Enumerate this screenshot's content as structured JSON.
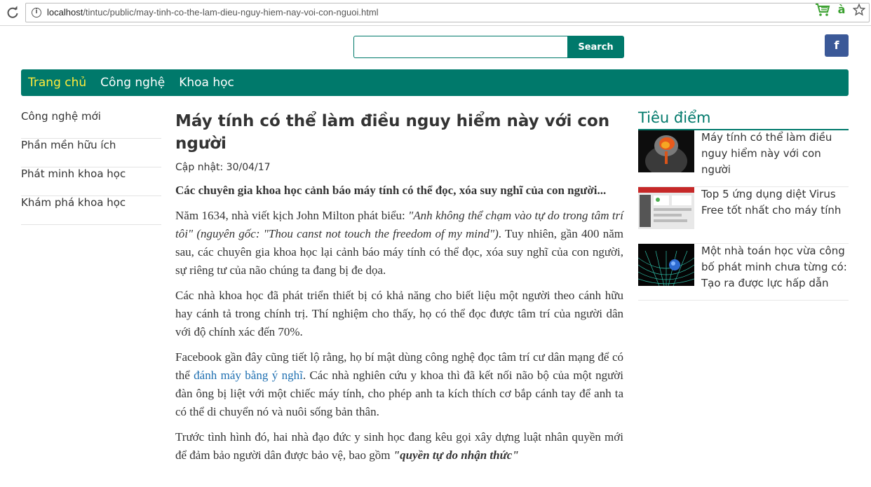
{
  "browser": {
    "url_host": "localhost",
    "url_path": "/tintuc/public/may-tinh-co-the-lam-dieu-nguy-hiem-nay-voi-con-nguoi.html",
    "icons": [
      "reload-icon",
      "info-icon",
      "cart-icon",
      "star-icon"
    ],
    "ext_letter": "à"
  },
  "search": {
    "value": "",
    "placeholder": "",
    "button_label": "Search"
  },
  "facebook": {
    "label": "f",
    "color": "#3b5998"
  },
  "nav": {
    "color": "#00796b",
    "items": [
      {
        "label": "Trang chủ",
        "active": true
      },
      {
        "label": "Công nghệ",
        "active": false
      },
      {
        "label": "Khoa học",
        "active": false
      }
    ]
  },
  "sidebar": {
    "items": [
      {
        "label": "Công nghệ mới"
      },
      {
        "label": "Phần mền hữu ích"
      },
      {
        "label": "Phát minh khoa học"
      },
      {
        "label": "Khám phá khoa học"
      }
    ]
  },
  "article": {
    "title": "Máy tính có thể làm điều nguy hiểm này với con người",
    "updated": "Cập nhật: 30/04/17",
    "lead": "Các chuyên gia khoa học cảnh báo máy tính có thể đọc, xóa suy nghĩ của con người...",
    "p1_a": "Năm 1634, nhà viết kịch John Milton phát biểu: ",
    "p1_quote": "\"Anh không thể chạm vào tự do trong tâm trí tôi\" (nguyên gốc: \"Thou canst not touch the freedom of my mind\")",
    "p1_b": ". Tuy nhiên, gần 400 năm sau, các chuyên gia khoa học lại cảnh báo máy tính có thể đọc, xóa suy nghĩ của con người, sự riêng tư của não chúng ta đang bị đe dọa.",
    "p2": "Các nhà khoa học đã phát triển thiết bị có khả năng cho biết liệu một người theo cánh hữu hay cánh tả trong chính trị. Thí nghiệm cho thấy, họ có thể đọc được tâm trí của người dân với độ chính xác đến 70%.",
    "p3_a": "Facebook gần đây cũng tiết lộ rằng, họ bí mật dùng công nghệ đọc tâm trí cư dân mạng để có thể ",
    "p3_link": "đánh máy bằng ý nghĩ",
    "p3_b": ". Các nhà nghiên cứu y khoa thì đã kết nối não bộ của một người đàn ông bị liệt với một chiếc máy tính, cho phép anh ta kích thích cơ bắp cánh tay để anh ta có thể di chuyển nó và nuôi sống bản thân.",
    "p4_a": "Trước tình hình đó, hai nhà đạo đức y sinh học đang kêu gọi xây dựng luật nhân quyền mới để đảm bảo người dân được bảo vệ, bao gồm ",
    "p4_bold": "\"quyền tự do nhận thức\""
  },
  "focus": {
    "title": "Tiêu điểm",
    "items": [
      {
        "title": "Máy tính có thể làm điều nguy hiểm này với con người",
        "thumb": "brain-thumbnail"
      },
      {
        "title": "Top 5 ứng dụng diệt Virus Free tốt nhất cho máy tính",
        "thumb": "antivirus-screenshot-thumbnail"
      },
      {
        "title": "Một nhà toán học vừa công bố phát minh chưa từng có: Tạo ra được lực hấp dẫn",
        "thumb": "gravity-grid-thumbnail"
      }
    ]
  }
}
